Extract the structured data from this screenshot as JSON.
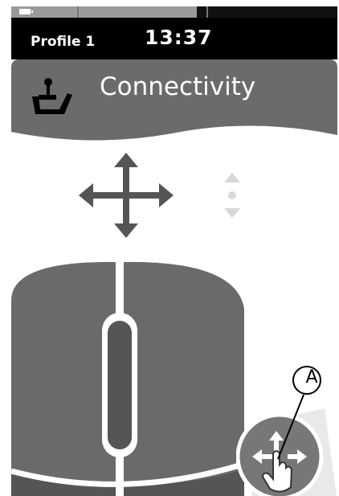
{
  "status_bar": {
    "profile_label": "Profile 1",
    "time": "13:37",
    "battery_icon": "battery-icon",
    "progress_fraction": 0.57
  },
  "header": {
    "title": "Connectivity",
    "icon": "joystick-seat-icon",
    "bg_color": "#6b6b6b"
  },
  "controls": {
    "move_icon": "four-way-arrows-icon",
    "updown_icon": "up-down-dot-icon",
    "mouse_icon": "mouse-icon",
    "touch_button_icon": "touch-move-icon"
  },
  "annotation": {
    "callout_letter": "A"
  }
}
